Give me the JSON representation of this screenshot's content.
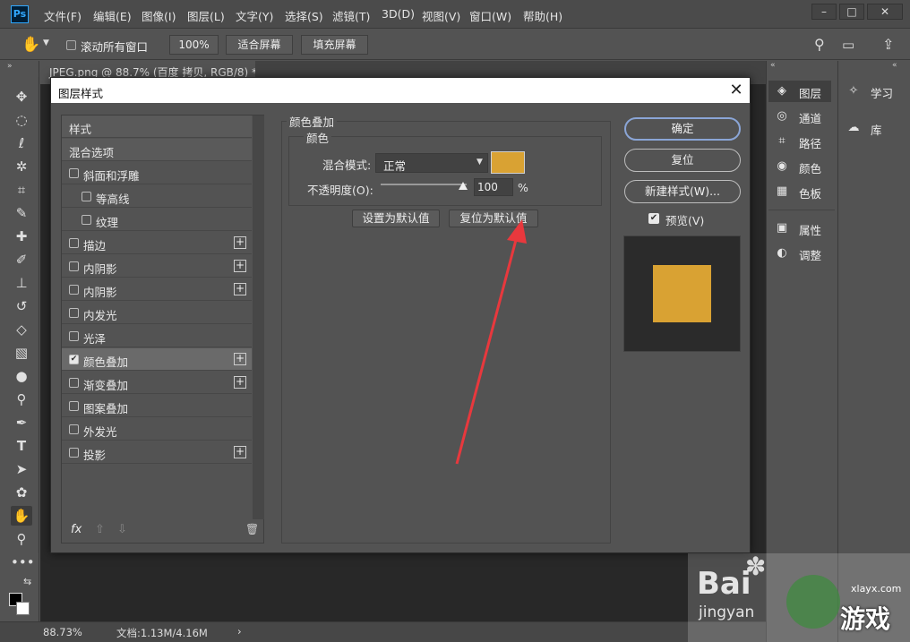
{
  "app": {
    "logo_text": "Ps"
  },
  "menubar": {
    "items": [
      "文件(F)",
      "编辑(E)",
      "图像(I)",
      "图层(L)",
      "文字(Y)",
      "选择(S)",
      "滤镜(T)",
      "3D(D)",
      "视图(V)",
      "窗口(W)",
      "帮助(H)"
    ],
    "win_min": "–",
    "win_max": "□",
    "win_close": "✕"
  },
  "optionsbar": {
    "scroll_all_label": "滚动所有窗口",
    "zoom_value": "100%",
    "fit_screen": "适合屏幕",
    "fill_screen": "填充屏幕"
  },
  "document": {
    "tab_title": "JPEG.png @ 88.7% (百度 拷贝, RGB/8) *",
    "status_zoom": "88.73%",
    "status_doc": "文档:1.13M/4.16M",
    "status_arrow": "›"
  },
  "panels": {
    "col1": [
      {
        "icon": "layers-icon",
        "glyph": "◈",
        "label": "图层",
        "active": true
      },
      {
        "icon": "channels-icon",
        "glyph": "◎",
        "label": "通道"
      },
      {
        "icon": "paths-icon",
        "glyph": "⌗",
        "label": "路径"
      },
      {
        "icon": "color-icon",
        "glyph": "◉",
        "label": "颜色"
      },
      {
        "icon": "swatches-icon",
        "glyph": "▦",
        "label": "色板"
      },
      {
        "icon": "properties-icon",
        "glyph": "▣",
        "label": "属性"
      },
      {
        "icon": "adjustments-icon",
        "glyph": "◐",
        "label": "调整"
      }
    ],
    "col2": [
      {
        "icon": "learn-icon",
        "glyph": "✧",
        "label": "学习"
      },
      {
        "icon": "libraries-icon",
        "glyph": "☁",
        "label": "库"
      }
    ]
  },
  "dialog": {
    "title": "图层样式",
    "close": "✕",
    "style_list": [
      {
        "label": "样式",
        "type": "header"
      },
      {
        "label": "混合选项",
        "type": "header"
      },
      {
        "label": "斜面和浮雕",
        "checkbox": true,
        "checked": false
      },
      {
        "label": "等高线",
        "checkbox": true,
        "checked": false,
        "indent": true
      },
      {
        "label": "纹理",
        "checkbox": true,
        "checked": false,
        "indent": true
      },
      {
        "label": "描边",
        "checkbox": true,
        "checked": false,
        "plus": true
      },
      {
        "label": "内阴影",
        "checkbox": true,
        "checked": false,
        "plus": true
      },
      {
        "label": "内阴影",
        "checkbox": true,
        "checked": false,
        "plus": true
      },
      {
        "label": "内发光",
        "checkbox": true,
        "checked": false
      },
      {
        "label": "光泽",
        "checkbox": true,
        "checked": false
      },
      {
        "label": "颜色叠加",
        "checkbox": true,
        "checked": true,
        "plus": true,
        "selected": true
      },
      {
        "label": "渐变叠加",
        "checkbox": true,
        "checked": false,
        "plus": true
      },
      {
        "label": "图案叠加",
        "checkbox": true,
        "checked": false
      },
      {
        "label": "外发光",
        "checkbox": true,
        "checked": false
      },
      {
        "label": "投影",
        "checkbox": true,
        "checked": false,
        "plus": true
      }
    ],
    "list_footer": {
      "fx": "fx",
      "up": "⇧",
      "down": "⇩",
      "trash": "🗑"
    },
    "section_title": "颜色叠加",
    "group_title": "颜色",
    "blend_mode_label": "混合模式:",
    "blend_mode_value": "正常",
    "overlay_color": "#d9a233",
    "opacity_label": "不透明度(O):",
    "opacity_value": "100",
    "opacity_level": 1.0,
    "percent": "%",
    "set_default": "设置为默认值",
    "reset_default": "复位为默认值",
    "ok": "确定",
    "reset": "复位",
    "new_style": "新建样式(W)...",
    "preview_label": "预览(V)",
    "preview_checked": true
  },
  "watermark": {
    "baidu": "Bai",
    "jingyan": "jingyan",
    "site": "xlayx.com",
    "game": "游戏"
  },
  "colors": {
    "arrow": "#e8383d",
    "accent_btn": "#8aa5d6"
  }
}
